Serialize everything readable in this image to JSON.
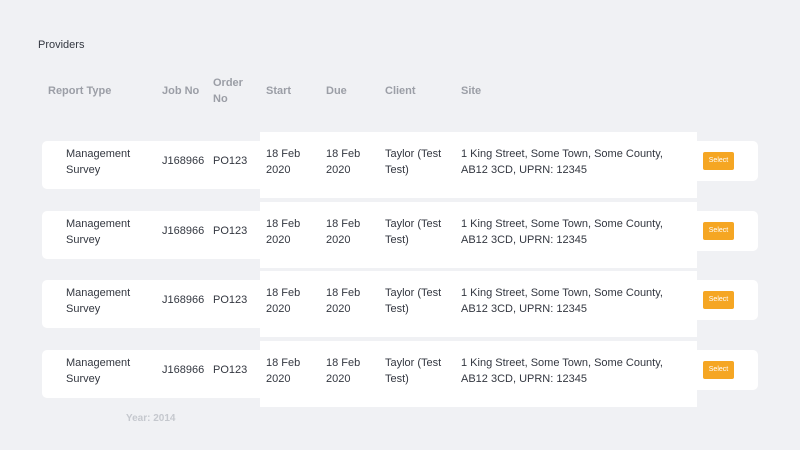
{
  "section": {
    "title": "Providers"
  },
  "columns": {
    "report_type": "Report Type",
    "job_no": "Job No",
    "order_no": "Order No",
    "start": "Start",
    "due": "Due",
    "client": "Client",
    "site": "Site"
  },
  "rows": [
    {
      "report_type": "Management Survey",
      "job_no": "J168966",
      "order_no": "PO123",
      "start": "18 Feb 2020",
      "due": "18 Feb 2020",
      "client": "Taylor (Test Test)",
      "site": "1 King Street, Some Town, Some County, AB12 3CD, UPRN: 12345",
      "action": "Select"
    },
    {
      "report_type": "Management Survey",
      "job_no": "J168966",
      "order_no": "PO123",
      "start": "18 Feb 2020",
      "due": "18 Feb 2020",
      "client": "Taylor (Test Test)",
      "site": "1 King Street, Some Town, Some County, AB12 3CD, UPRN: 12345",
      "action": "Select"
    },
    {
      "report_type": "Management Survey",
      "job_no": "J168966",
      "order_no": "PO123",
      "start": "18 Feb 2020",
      "due": "18 Feb 2020",
      "client": "Taylor (Test Test)",
      "site": "1 King Street, Some Town, Some County, AB12 3CD, UPRN: 12345",
      "action": "Select"
    },
    {
      "report_type": "Management Survey",
      "job_no": "J168966",
      "order_no": "PO123",
      "start": "18 Feb 2020",
      "due": "18 Feb 2020",
      "client": "Taylor (Test Test)",
      "site": "1 King Street, Some Town, Some County, AB12 3CD, UPRN: 12345",
      "action": "Select"
    }
  ],
  "footer": {
    "year": "Year: 2014"
  },
  "colors": {
    "accent": "#f5a623",
    "background": "#f0f1f4",
    "row_background": "#ffffff",
    "header_text": "#9b9ea6",
    "footer_text": "#c5c8ce"
  }
}
